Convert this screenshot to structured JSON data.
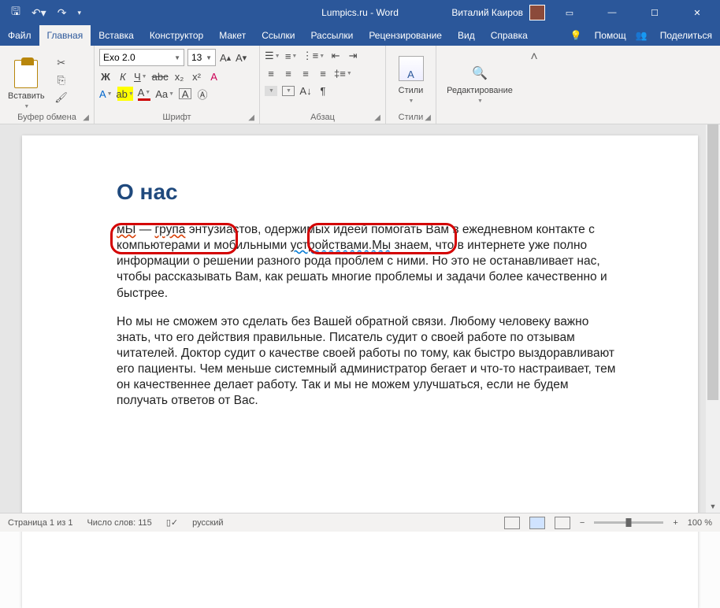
{
  "titlebar": {
    "doc_title": "Lumpics.ru - Word",
    "user_name": "Виталий Каиров"
  },
  "tabs": {
    "file": "Файл",
    "home": "Главная",
    "insert": "Вставка",
    "design": "Конструктор",
    "layout": "Макет",
    "references": "Ссылки",
    "mailings": "Рассылки",
    "review": "Рецензирование",
    "view": "Вид",
    "help": "Справка",
    "tell_me": "Помощ",
    "share": "Поделиться"
  },
  "ribbon": {
    "clipboard": {
      "paste": "Вставить",
      "group": "Буфер обмена"
    },
    "font": {
      "name": "Exo 2.0",
      "size": "13",
      "group": "Шрифт"
    },
    "paragraph": {
      "group": "Абзац"
    },
    "styles": {
      "btn": "Стили",
      "group": "Стили"
    },
    "editing": {
      "btn": "Редактирование"
    }
  },
  "document": {
    "heading": "О нас",
    "p1_part1": "мЫ",
    "p1_part2": " — ",
    "p1_part3": "група",
    "p1_part4": " энтузиастов, одержимых идеей помогать Вам в ежедневном контакте с компьютерами и мобильными ",
    "p1_part5": "устройствами.Мы",
    "p1_part6": " знаем, что в интернете уже полно информации о решении разного рода проблем с ними. Но это не останавливает нас, чтобы рассказывать Вам, как решать многие проблемы и задачи более качественно и быстрее.",
    "p2": "Но мы не сможем это сделать без Вашей обратной связи. Любому человеку важно знать, что его действия правильные. Писатель судит о своей работе по отзывам читателей. Доктор судит о качестве своей работы по тому, как быстро выздоравливают его пациенты. Чем меньше системный администратор бегает и что-то настраивает, тем он качественнее делает работу. Так и мы не можем улучшаться, если не будем получать ответов от Вас."
  },
  "status": {
    "page": "Страница 1 из 1",
    "words": "Число слов: 115",
    "lang": "русский",
    "zoom": "100 %"
  }
}
